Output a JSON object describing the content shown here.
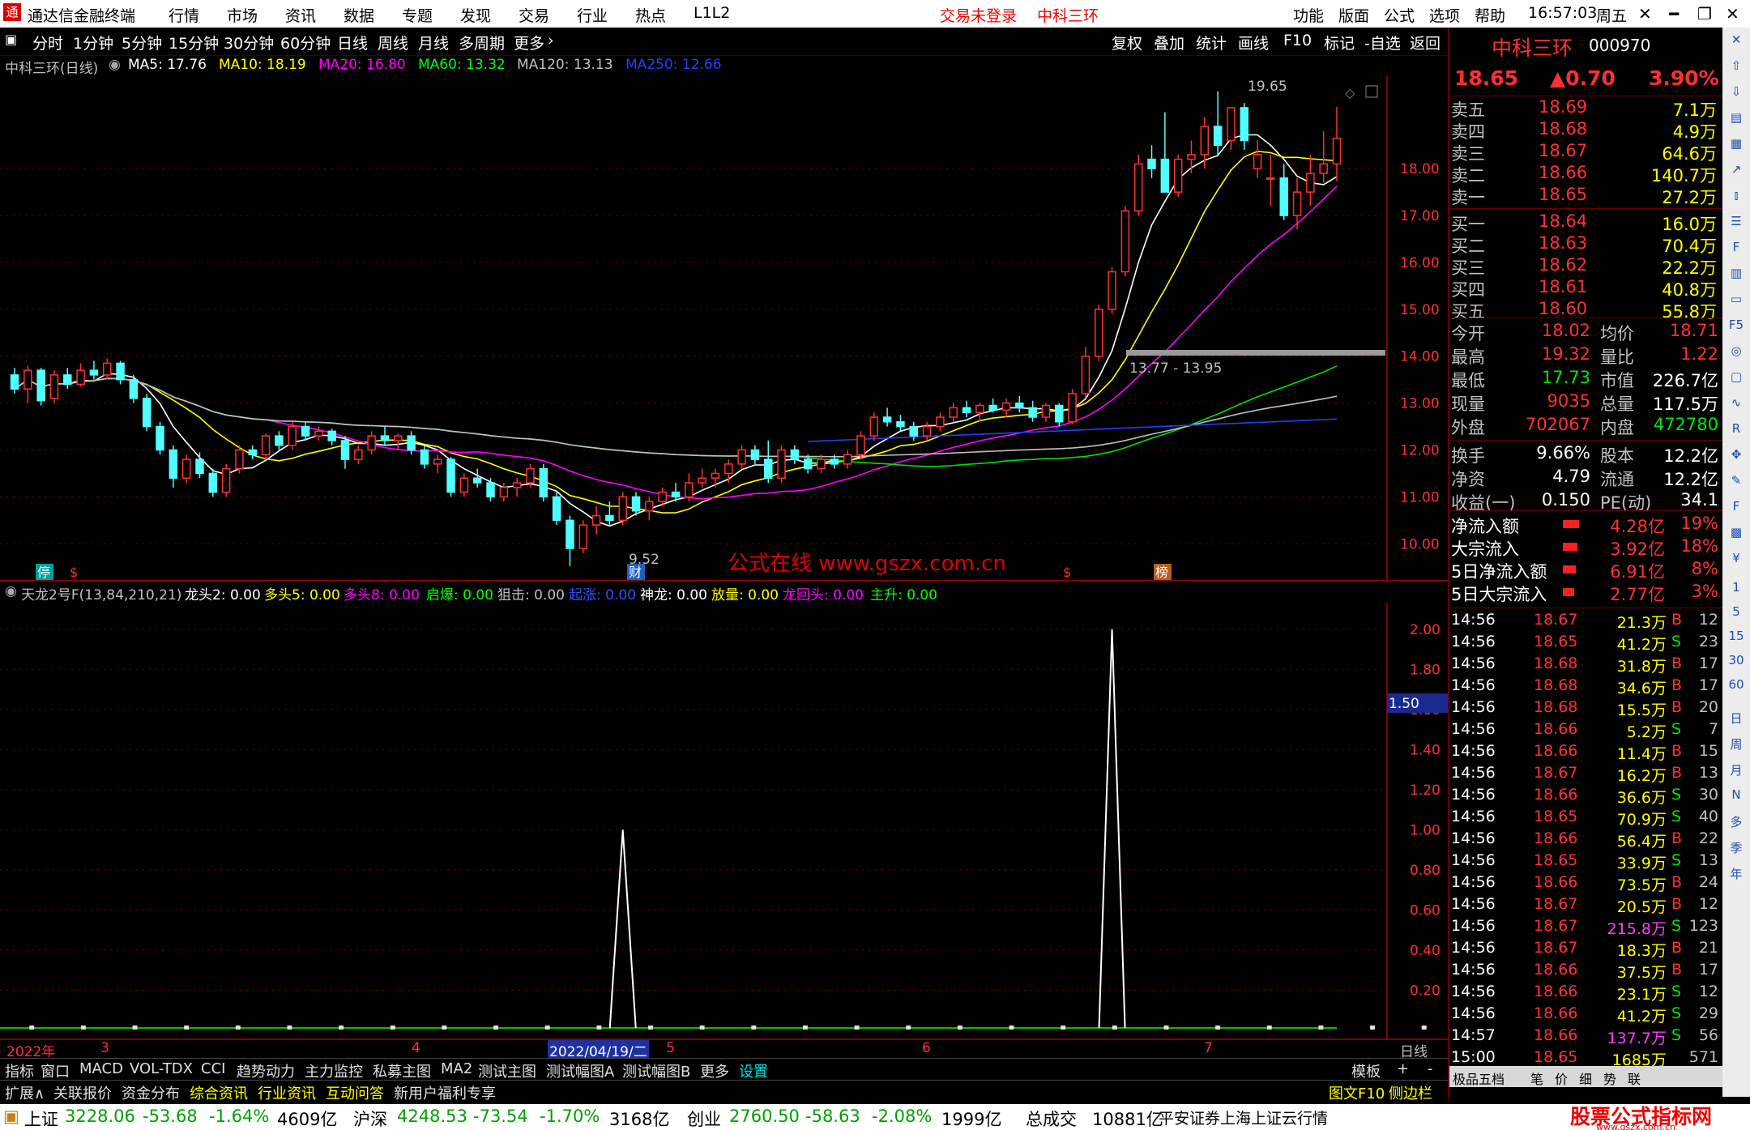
{
  "menubar": {
    "app_name": "通达信金融终端",
    "items": [
      "行情",
      "市场",
      "资讯",
      "数据",
      "专题",
      "发现",
      "交易",
      "行业",
      "热点",
      "L1L2"
    ],
    "login_status": "交易未登录",
    "stock_name": "中科三环",
    "right_items": [
      "功能",
      "版面",
      "公式",
      "选项",
      "帮助"
    ],
    "time": "16:57:03",
    "weekday": "周五"
  },
  "toolbar": {
    "periods": [
      "分时",
      "1分钟",
      "5分钟",
      "15分钟",
      "30分钟",
      "60分钟",
      "日线",
      "周线",
      "月线",
      "多周期",
      "更多"
    ],
    "active_period": "日线",
    "actions": [
      "复权",
      "叠加",
      "统计",
      "画线",
      "F10",
      "标记",
      "-自选",
      "返回"
    ]
  },
  "ma_line": {
    "title": "中科三环(日线)",
    "ma": [
      {
        "label": "MA5: 17.76",
        "color": "#ffffff"
      },
      {
        "label": "MA10: 18.19",
        "color": "#ffff00"
      },
      {
        "label": "MA20: 16.80",
        "color": "#ff00ff"
      },
      {
        "label": "MA60: 13.32",
        "color": "#00ff00"
      },
      {
        "label": "MA120: 13.13",
        "color": "#c0c0c0"
      },
      {
        "label": "MA250: 12.66",
        "color": "#2040ff"
      }
    ]
  },
  "main_chart": {
    "price_ticks": [
      "18.00",
      "17.00",
      "16.00",
      "15.00",
      "14.00",
      "13.00",
      "12.00",
      "11.00",
      "10.00"
    ],
    "high_label": "19.65",
    "low_label": "9.52",
    "range_label": "13.77 - 13.95",
    "watermark": "公式在线  www.gszx.com.cn",
    "markers": [
      "停",
      "$",
      "财",
      "$",
      "榜"
    ]
  },
  "chart_data": [
    {
      "type": "candlestick",
      "title": "中科三环(日线)",
      "ylim": [
        9.4,
        19.8
      ],
      "candles": [
        [
          13.6,
          13.75,
          13.2,
          13.3
        ],
        [
          13.3,
          13.8,
          13.0,
          13.7
        ],
        [
          13.7,
          13.75,
          12.95,
          13.05
        ],
        [
          13.1,
          13.7,
          13.0,
          13.6
        ],
        [
          13.6,
          13.75,
          13.3,
          13.4
        ],
        [
          13.4,
          13.85,
          13.35,
          13.7
        ],
        [
          13.7,
          13.9,
          13.5,
          13.6
        ],
        [
          13.6,
          13.95,
          13.5,
          13.85
        ],
        [
          13.85,
          13.9,
          13.4,
          13.5
        ],
        [
          13.5,
          13.6,
          13.0,
          13.1
        ],
        [
          13.1,
          13.2,
          12.4,
          12.5
        ],
        [
          12.5,
          12.6,
          11.9,
          12.0
        ],
        [
          12.0,
          12.1,
          11.2,
          11.4
        ],
        [
          11.4,
          11.9,
          11.3,
          11.8
        ],
        [
          11.8,
          11.95,
          11.4,
          11.5
        ],
        [
          11.5,
          11.6,
          11.0,
          11.1
        ],
        [
          11.1,
          11.7,
          11.0,
          11.6
        ],
        [
          11.6,
          12.1,
          11.5,
          12.0
        ],
        [
          12.0,
          12.1,
          11.8,
          11.9
        ],
        [
          11.9,
          12.35,
          11.8,
          12.3
        ],
        [
          12.3,
          12.4,
          12.0,
          12.1
        ],
        [
          12.1,
          12.6,
          12.0,
          12.5
        ],
        [
          12.5,
          12.6,
          12.2,
          12.3
        ],
        [
          12.3,
          12.5,
          12.2,
          12.4
        ],
        [
          12.4,
          12.45,
          12.1,
          12.2
        ],
        [
          12.2,
          12.3,
          11.6,
          11.8
        ],
        [
          11.8,
          12.1,
          11.7,
          12.0
        ],
        [
          12.0,
          12.4,
          11.9,
          12.3
        ],
        [
          12.3,
          12.5,
          12.1,
          12.2
        ],
        [
          12.2,
          12.35,
          12.0,
          12.3
        ],
        [
          12.3,
          12.4,
          11.9,
          12.0
        ],
        [
          12.0,
          12.1,
          11.6,
          11.7
        ],
        [
          11.7,
          11.9,
          11.5,
          11.8
        ],
        [
          11.8,
          11.85,
          11.0,
          11.1
        ],
        [
          11.1,
          11.5,
          11.0,
          11.4
        ],
        [
          11.4,
          11.6,
          11.2,
          11.3
        ],
        [
          11.3,
          11.4,
          10.9,
          11.0
        ],
        [
          11.0,
          11.3,
          10.9,
          11.2
        ],
        [
          11.2,
          11.4,
          11.0,
          11.3
        ],
        [
          11.3,
          11.7,
          11.2,
          11.6
        ],
        [
          11.6,
          11.7,
          10.9,
          11.0
        ],
        [
          11.0,
          11.1,
          10.4,
          10.5
        ],
        [
          10.5,
          10.6,
          9.52,
          9.9
        ],
        [
          9.9,
          10.5,
          9.8,
          10.4
        ],
        [
          10.4,
          10.8,
          10.2,
          10.6
        ],
        [
          10.6,
          10.9,
          10.4,
          10.5
        ],
        [
          10.5,
          11.1,
          10.4,
          11.0
        ],
        [
          11.0,
          11.1,
          10.6,
          10.7
        ],
        [
          10.7,
          11.0,
          10.5,
          10.9
        ],
        [
          10.9,
          11.2,
          10.8,
          11.1
        ],
        [
          11.1,
          11.3,
          10.9,
          11.0
        ],
        [
          11.0,
          11.5,
          10.9,
          11.3
        ],
        [
          11.3,
          11.6,
          11.2,
          11.4
        ],
        [
          11.4,
          11.6,
          11.2,
          11.5
        ],
        [
          11.5,
          11.8,
          11.3,
          11.7
        ],
        [
          11.7,
          12.1,
          11.6,
          12.0
        ],
        [
          12.0,
          12.1,
          11.7,
          11.8
        ],
        [
          11.8,
          12.2,
          11.3,
          11.4
        ],
        [
          11.4,
          12.1,
          11.3,
          12.0
        ],
        [
          12.0,
          12.1,
          11.7,
          11.8
        ],
        [
          11.8,
          11.9,
          11.5,
          11.6
        ],
        [
          11.6,
          11.9,
          11.5,
          11.8
        ],
        [
          11.8,
          11.9,
          11.6,
          11.7
        ],
        [
          11.7,
          12.0,
          11.6,
          11.9
        ],
        [
          11.9,
          12.4,
          11.8,
          12.3
        ],
        [
          12.3,
          12.8,
          12.2,
          12.7
        ],
        [
          12.7,
          12.9,
          12.5,
          12.6
        ],
        [
          12.6,
          12.75,
          12.4,
          12.5
        ],
        [
          12.5,
          12.6,
          12.2,
          12.3
        ],
        [
          12.3,
          12.6,
          12.2,
          12.5
        ],
        [
          12.5,
          12.8,
          12.4,
          12.7
        ],
        [
          12.7,
          13.0,
          12.6,
          12.9
        ],
        [
          12.9,
          13.05,
          12.7,
          12.8
        ],
        [
          12.8,
          13.0,
          12.6,
          12.95
        ],
        [
          12.95,
          13.1,
          12.8,
          12.85
        ],
        [
          12.85,
          13.1,
          12.7,
          13.0
        ],
        [
          13.0,
          13.15,
          12.8,
          12.9
        ],
        [
          12.9,
          13.05,
          12.6,
          12.7
        ],
        [
          12.7,
          13.0,
          12.6,
          12.95
        ],
        [
          12.95,
          13.0,
          12.5,
          12.6
        ],
        [
          12.6,
          13.3,
          12.55,
          13.2
        ],
        [
          13.2,
          14.2,
          13.1,
          14.0
        ],
        [
          14.0,
          15.1,
          13.9,
          15.0
        ],
        [
          15.0,
          15.9,
          14.9,
          15.8
        ],
        [
          15.8,
          17.2,
          15.7,
          17.1
        ],
        [
          17.1,
          18.3,
          17.0,
          18.1
        ],
        [
          18.2,
          18.5,
          17.8,
          18.0
        ],
        [
          18.2,
          19.2,
          17.5,
          17.5
        ],
        [
          17.5,
          18.3,
          17.4,
          18.2
        ],
        [
          18.2,
          18.6,
          17.9,
          18.3
        ],
        [
          18.3,
          19.1,
          18.0,
          18.9
        ],
        [
          18.9,
          19.65,
          18.3,
          18.5
        ],
        [
          18.6,
          19.3,
          18.4,
          19.3
        ],
        [
          19.3,
          19.4,
          18.4,
          18.6
        ],
        [
          18.0,
          18.6,
          17.8,
          18.3
        ],
        [
          17.8,
          18.3,
          17.2,
          17.8
        ],
        [
          17.8,
          18.1,
          16.9,
          17.0
        ],
        [
          17.0,
          17.8,
          16.7,
          17.5
        ],
        [
          17.5,
          18.3,
          17.2,
          17.9
        ],
        [
          17.9,
          18.8,
          17.7,
          18.1
        ],
        [
          18.1,
          19.32,
          17.73,
          18.65
        ]
      ]
    },
    {
      "type": "line",
      "title": "天龙2号F(13,84,210,21)",
      "ylim": [
        0,
        2.1
      ],
      "yticks": [
        "2.00",
        "1.80",
        "1.60",
        "1.40",
        "1.20",
        "1.00",
        "0.80",
        "0.60",
        "0.40",
        "0.20"
      ],
      "spikes": [
        {
          "bar": 46,
          "value": 1.0
        },
        {
          "bar": 83,
          "value": 2.0
        }
      ],
      "current_value_label": "1.50"
    }
  ],
  "indicator": {
    "title": "天龙2号F(13,84,210,21)",
    "items": [
      {
        "label": "龙头2: 0.00",
        "color": "#ffffff"
      },
      {
        "label": "多头5: 0.00",
        "color": "#ffff00"
      },
      {
        "label": "多头8: 0.00",
        "color": "#ff00ff"
      },
      {
        "label": "启爆: 0.00",
        "color": "#00ff00"
      },
      {
        "label": "狙击: 0.00",
        "color": "#c0c0c0"
      },
      {
        "label": "起涨: 0.00",
        "color": "#3050ff"
      },
      {
        "label": "神龙: 0.00",
        "color": "#ffffff"
      },
      {
        "label": "放量: 0.00",
        "color": "#ffff00"
      },
      {
        "label": "龙回头: 0.00",
        "color": "#ff00ff"
      },
      {
        "label": "主升: 0.00",
        "color": "#00ff00"
      }
    ]
  },
  "date_axis": {
    "labels": [
      "2022年",
      "3",
      "4",
      "2022/04/19/二",
      "5",
      "6",
      "7"
    ],
    "period": "日线"
  },
  "bottom_tabs1": [
    "指标",
    "窗口",
    "MACD",
    "VOL-TDX",
    "CCI",
    "趋势动力",
    "主力监控",
    "私募主图",
    "MA2",
    "测试主图",
    "测试幅图A",
    "测试幅图B",
    "更多",
    "设置"
  ],
  "bottom_tabs1_right": [
    "模板",
    "+",
    "-"
  ],
  "bottom_tabs2": [
    "扩展∧",
    "关联报价",
    "资金分布",
    "综合资讯",
    "行业资讯",
    "互动问答",
    "新用户福利专享"
  ],
  "bottom_tabs2_right": [
    "图文F10",
    "侧边栏"
  ],
  "quote": {
    "name": "中科三环",
    "code": "000970",
    "price": "18.65",
    "change": "▲0.70",
    "pct": "3.90%",
    "asks": [
      [
        "卖五",
        "18.69",
        "7.1万"
      ],
      [
        "卖四",
        "18.68",
        "4.9万"
      ],
      [
        "卖三",
        "18.67",
        "64.6万"
      ],
      [
        "卖二",
        "18.66",
        "140.7万"
      ],
      [
        "卖一",
        "18.65",
        "27.2万"
      ]
    ],
    "bids": [
      [
        "买一",
        "18.64",
        "16.0万"
      ],
      [
        "买二",
        "18.63",
        "70.4万"
      ],
      [
        "买三",
        "18.62",
        "22.2万"
      ],
      [
        "买四",
        "18.61",
        "40.8万"
      ],
      [
        "买五",
        "18.60",
        "55.8万"
      ]
    ],
    "stats": [
      [
        "今开",
        "18.02",
        "均价",
        "18.71"
      ],
      [
        "最高",
        "19.32",
        "量比",
        "1.22"
      ],
      [
        "最低",
        "17.73",
        "市值",
        "226.7亿"
      ],
      [
        "现量",
        "9035",
        "总量",
        "117.5万"
      ],
      [
        "外盘",
        "702067",
        "内盘",
        "472780"
      ],
      [
        "换手",
        "9.66%",
        "股本",
        "12.2亿"
      ],
      [
        "净资",
        "4.79",
        "流通",
        "12.2亿"
      ],
      [
        "收益(一)",
        "0.150",
        "PE(动)",
        "34.1"
      ]
    ],
    "flows": [
      [
        "净流入额",
        "4.28亿",
        "19%"
      ],
      [
        "大宗流入",
        "3.92亿",
        "18%"
      ],
      [
        "5日净流入额",
        "6.91亿",
        "8%"
      ],
      [
        "5日大宗流入",
        "2.77亿",
        "3%"
      ]
    ],
    "ticks": [
      [
        "14:56",
        "18.67",
        "21.3万",
        "B",
        "12"
      ],
      [
        "14:56",
        "18.65",
        "41.2万",
        "S",
        "23"
      ],
      [
        "14:56",
        "18.68",
        "31.8万",
        "B",
        "17"
      ],
      [
        "14:56",
        "18.68",
        "34.6万",
        "B",
        "17"
      ],
      [
        "14:56",
        "18.68",
        "15.5万",
        "B",
        "20"
      ],
      [
        "14:56",
        "18.66",
        "5.2万",
        "S",
        "7"
      ],
      [
        "14:56",
        "18.66",
        "11.4万",
        "B",
        "15"
      ],
      [
        "14:56",
        "18.67",
        "16.2万",
        "B",
        "13"
      ],
      [
        "14:56",
        "18.66",
        "36.6万",
        "S",
        "30"
      ],
      [
        "14:56",
        "18.65",
        "70.9万",
        "S",
        "40"
      ],
      [
        "14:56",
        "18.66",
        "56.4万",
        "B",
        "22"
      ],
      [
        "14:56",
        "18.65",
        "33.9万",
        "S",
        "13"
      ],
      [
        "14:56",
        "18.66",
        "73.5万",
        "B",
        "24"
      ],
      [
        "14:56",
        "18.67",
        "20.5万",
        "B",
        "12"
      ],
      [
        "14:56",
        "18.67",
        "215.8万",
        "S",
        "123"
      ],
      [
        "14:56",
        "18.67",
        "18.3万",
        "B",
        "21"
      ],
      [
        "14:56",
        "18.66",
        "37.5万",
        "B",
        "17"
      ],
      [
        "14:56",
        "18.66",
        "23.1万",
        "S",
        "12"
      ],
      [
        "14:56",
        "18.66",
        "41.2万",
        "S",
        "29"
      ],
      [
        "14:57",
        "18.66",
        "137.7万",
        "S",
        "56"
      ],
      [
        "15:00",
        "18.65",
        "1685万",
        "",
        "571"
      ]
    ],
    "tabs": [
      "极品五档",
      "笔",
      "价",
      "细",
      "势",
      "联"
    ]
  },
  "icon_column": [
    "日",
    "周",
    "月",
    "N",
    "多",
    "季",
    "年",
    "15",
    "30",
    "60",
    "1",
    "5"
  ],
  "statusbar": {
    "items": [
      {
        "name": "上证",
        "value": "3228.06",
        "chg": "-53.68",
        "pct": "-1.64%",
        "amt": "4609亿"
      },
      {
        "name": "沪深",
        "value": "4248.53",
        "chg": "-73.54",
        "pct": "-1.70%",
        "amt": "3168亿"
      },
      {
        "name": "创业",
        "value": "2760.50",
        "chg": "-58.63",
        "pct": "-2.08%",
        "amt": "1999亿"
      }
    ],
    "total_label": "总成交",
    "total_value": "10881亿",
    "broker": "平安证券上海上证云行情",
    "logo_text": "股票公式指标网",
    "logo_url": "www.gszx.com.cn"
  }
}
